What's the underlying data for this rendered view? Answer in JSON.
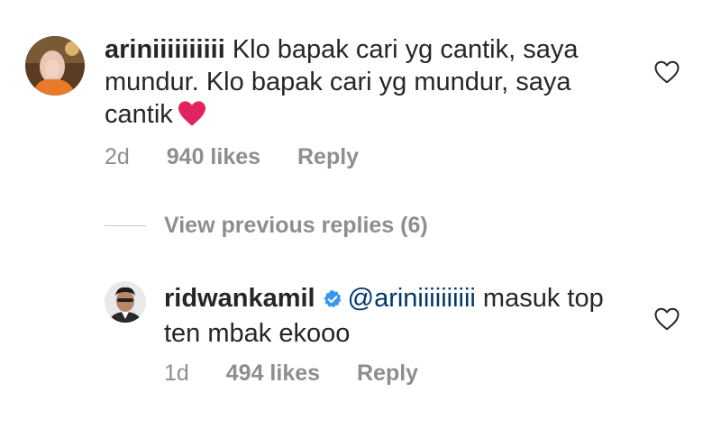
{
  "comments": [
    {
      "username": "ariniiiiiiiiii",
      "text": "Klo bapak cari yg cantik, saya mundur. Klo bapak cari yg mundur, saya cantik",
      "time": "2d",
      "likes": "940 likes",
      "reply_label": "Reply",
      "emoji": "red-heart",
      "liked": false
    },
    {
      "username": "ridwankamil",
      "verified": true,
      "mention": "@ariniiiiiiiiii",
      "text": "masuk top ten mbak ekooo",
      "time": "1d",
      "likes": "494 likes",
      "reply_label": "Reply",
      "liked": false
    }
  ],
  "view_replies": "View previous replies (6)",
  "colors": {
    "text": "#262626",
    "secondary": "#8e8e8e",
    "mention": "#00376b",
    "verified_badge": "#3897f0",
    "heart_emoji": "#e0245e"
  }
}
